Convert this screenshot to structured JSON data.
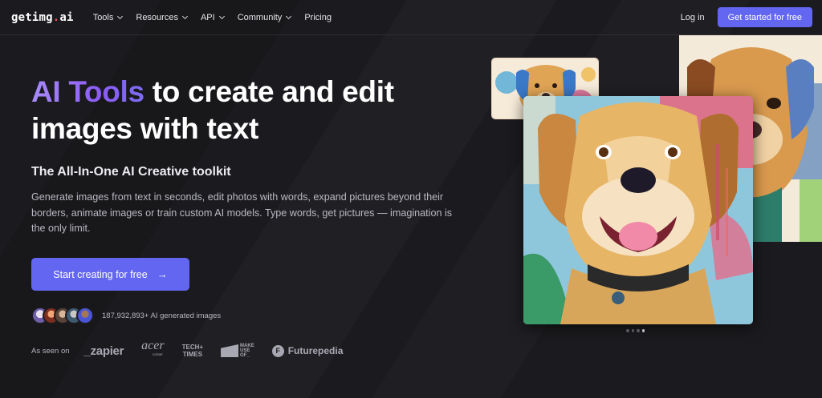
{
  "nav": {
    "logo_main": "getimg",
    "logo_dot": ".",
    "logo_suffix": "ai",
    "items": [
      {
        "label": "Tools",
        "has_dropdown": true
      },
      {
        "label": "Resources",
        "has_dropdown": true
      },
      {
        "label": "API",
        "has_dropdown": true
      },
      {
        "label": "Community",
        "has_dropdown": true
      },
      {
        "label": "Pricing",
        "has_dropdown": false
      }
    ],
    "login": "Log in",
    "cta": "Get started for free"
  },
  "hero": {
    "headline_highlight": "AI Tools",
    "headline_line1_rest": " to create and edit",
    "headline_line2": "images with text",
    "subheadline": "The All-In-One AI Creative toolkit",
    "description": "Generate images from text in seconds, edit photos with words, expand pictures beyond their borders, animate images or train custom AI models. Type words, get pictures — imagination is the only limit.",
    "cta_label": "Start creating for free",
    "cta_arrow": "→"
  },
  "social_proof": {
    "count_text": "187,932,893+ AI generated images"
  },
  "as_seen_on": {
    "label": "As seen on",
    "brands": {
      "zapier": "_zapier",
      "acer_main": "acer",
      "acer_sub": "corner",
      "tech_line1": "TECH+",
      "tech_line2": "TIMES",
      "makeuse_1": "MAKE",
      "makeuse_2": "USE",
      "makeuse_3": "OF_",
      "futurepedia_icon": "F",
      "futurepedia": "Futurepedia"
    }
  },
  "carousel": {
    "total_slides": 4,
    "active_index": 3
  },
  "colors": {
    "background": "#1b1b1f",
    "accent": "#6366f1",
    "highlight_gradient_start": "#a78bfa",
    "logo_dot": "#e94d5f"
  }
}
